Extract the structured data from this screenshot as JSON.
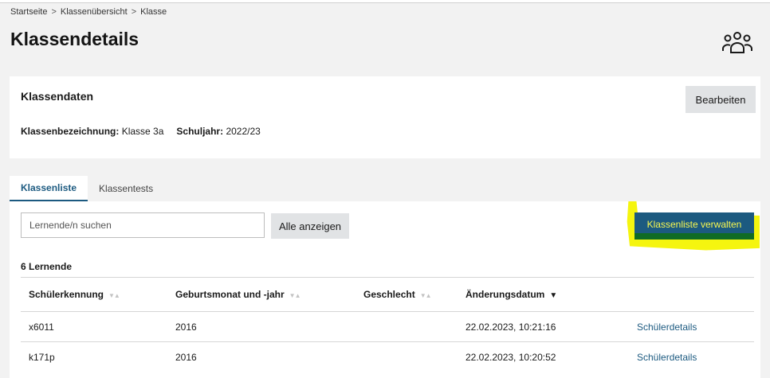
{
  "breadcrumb": {
    "items": [
      "Startseite",
      "Klassenübersicht",
      "Klasse"
    ],
    "separator": ">"
  },
  "page": {
    "title": "Klassendetails",
    "icon": "group-icon"
  },
  "class_data": {
    "title": "Klassendaten",
    "edit_label": "Bearbeiten",
    "designation_label": "Klassenbezeichnung:",
    "designation_value": "Klasse 3a",
    "year_label": "Schuljahr:",
    "year_value": "2022/23"
  },
  "tabs": [
    {
      "label": "Klassenliste",
      "active": true
    },
    {
      "label": "Klassentests",
      "active": false
    }
  ],
  "list": {
    "search_placeholder": "Lernende/n suchen",
    "show_all_label": "Alle anzeigen",
    "manage_label": "Klassenliste verwalten",
    "count_label": "6 Lernende",
    "columns": [
      "Schülerkennung",
      "Geburtsmonat und -jahr",
      "Geschlecht",
      "Änderungsdatum",
      ""
    ],
    "rows": [
      {
        "id": "x6011",
        "birth": "2016",
        "gender": "",
        "changed": "22.02.2023, 10:21:16",
        "link": "Schülerdetails"
      },
      {
        "id": "k171p",
        "birth": "2016",
        "gender": "",
        "changed": "22.02.2023, 10:20:52",
        "link": "Schülerdetails"
      }
    ]
  },
  "colors": {
    "primary": "#1c5a80",
    "highlight": "#f5f50f",
    "background": "#f2f2f2"
  }
}
